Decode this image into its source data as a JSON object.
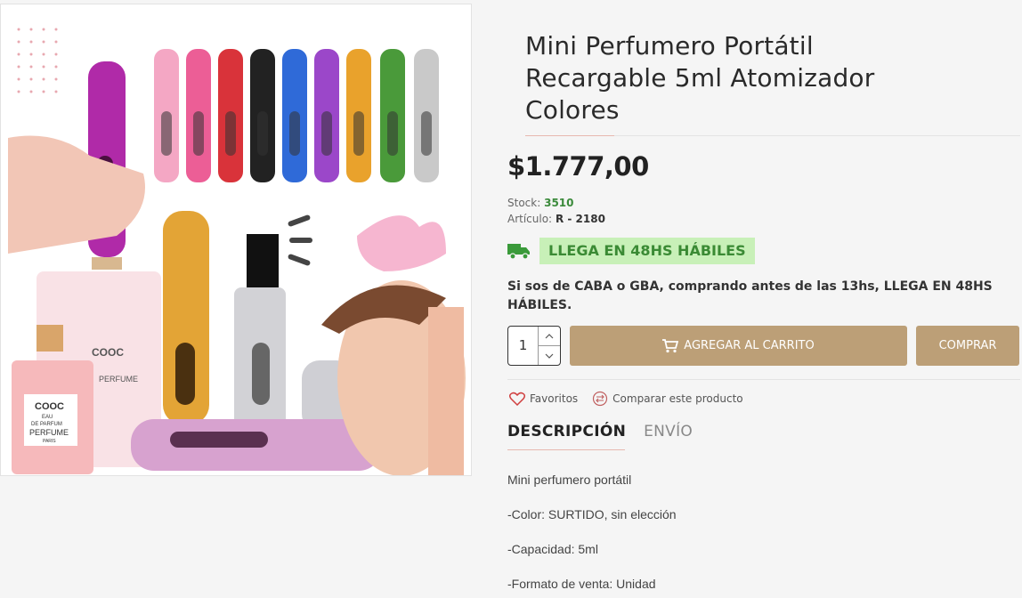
{
  "product": {
    "title_lines": [
      "Mini Perfumero Portátil",
      "Recargable 5ml Atomizador",
      "Colores"
    ],
    "price": "$1.777,00",
    "stock_label": "Stock:",
    "stock_value": "3510",
    "sku_label": "Artículo:",
    "sku_value": "R - 2180",
    "delivery_badge": "LLEGA EN 48HS HÁBILES",
    "delivery_notice": "Si sos de CABA o GBA, comprando antes de las 13hs, LLEGA EN 48HS HÁBILES."
  },
  "purchase": {
    "quantity": "1",
    "add_to_cart_label": "AGREGAR AL CARRITO",
    "buy_label": "COMPRAR"
  },
  "actions": {
    "favorites_label": "Favoritos",
    "compare_label": "Comparar este producto"
  },
  "tabs": [
    {
      "label": "DESCRIPCIÓN",
      "active": true
    },
    {
      "label": "ENVÍO",
      "active": false
    }
  ],
  "description": [
    "Mini perfumero portátil",
    "-Color: SURTIDO, sin elección",
    "-Capacidad: 5ml",
    "-Formato de venta: Unidad"
  ],
  "image": {
    "bottle_label_brand": "COOC",
    "bottle_label_line1": "EAU",
    "bottle_label_line2": "DE PARFUM",
    "bottle_label_line3": "PERFUME",
    "bottle_label_line4": "PARIS"
  },
  "colors": {
    "accent": "#bc9f77",
    "badge_bg": "#c8f0b8",
    "badge_text": "#3a8a34",
    "stock_green": "#3b8a3b"
  },
  "icons": [
    "truck-icon",
    "cart-icon",
    "heart-icon",
    "compare-icon",
    "chevron-up-icon",
    "chevron-down-icon"
  ]
}
